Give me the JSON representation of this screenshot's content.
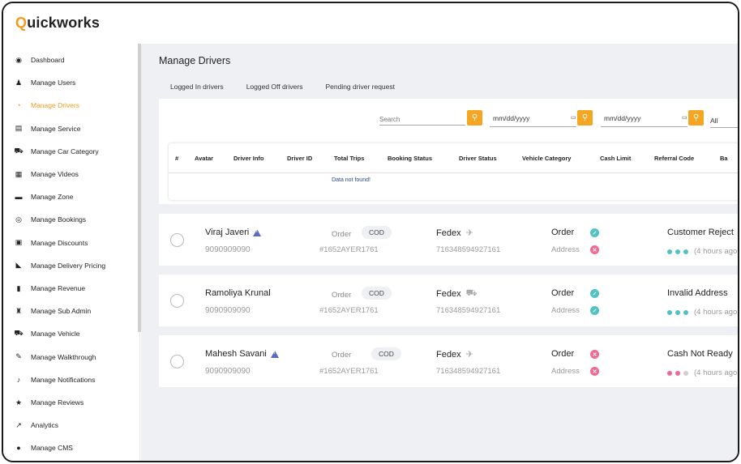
{
  "app": {
    "logo_first": "Q",
    "logo_rest": "uickworks"
  },
  "sidebar": {
    "items": [
      {
        "label": "Dashboard",
        "icon": "dashboard-icon",
        "glyph": "◉"
      },
      {
        "label": "Manage Users",
        "icon": "user-icon",
        "glyph": "♟"
      },
      {
        "label": "Manage Drivers",
        "icon": "driver-icon",
        "glyph": "◔",
        "active": true
      },
      {
        "label": "Manage Service",
        "icon": "service-icon",
        "glyph": "▤"
      },
      {
        "label": "Manage Car Category",
        "icon": "car-icon",
        "glyph": "⛟"
      },
      {
        "label": "Manage Videos",
        "icon": "calendar-icon",
        "glyph": "▦"
      },
      {
        "label": "Manage Zone",
        "icon": "briefcase-icon",
        "glyph": "▬"
      },
      {
        "label": "Manage Bookings",
        "icon": "target-icon",
        "glyph": "◎"
      },
      {
        "label": "Manage Discounts",
        "icon": "image-icon",
        "glyph": "▣"
      },
      {
        "label": "Manage Delivery Pricing",
        "icon": "area-chart-icon",
        "glyph": "◣"
      },
      {
        "label": "Manage Revenue",
        "icon": "bar-chart-icon",
        "glyph": "▮"
      },
      {
        "label": "Manage Sub Admin",
        "icon": "admin-icon",
        "glyph": "♜"
      },
      {
        "label": "Manage Vehicle",
        "icon": "vehicle-icon",
        "glyph": "⛟"
      },
      {
        "label": "Manage Walkthrough",
        "icon": "walkthrough-icon",
        "glyph": "✎"
      },
      {
        "label": "Manage Notifications",
        "icon": "bell-icon",
        "glyph": "♪"
      },
      {
        "label": "Manage Reviews",
        "icon": "star-icon",
        "glyph": "★"
      },
      {
        "label": "Analytics",
        "icon": "analytics-icon",
        "glyph": "↗"
      },
      {
        "label": "Manage CMS",
        "icon": "info-icon",
        "glyph": "●"
      }
    ]
  },
  "main": {
    "title": "Manage Drivers",
    "tabs": [
      {
        "label": "Logged In drivers",
        "active": true
      },
      {
        "label": "Logged Off drivers"
      },
      {
        "label": "Pending driver request"
      }
    ],
    "filters": {
      "search_placeholder": "Search",
      "date1": "mm/dd/yyyy",
      "date2": "mm/dd/yyyy",
      "select_value": "All"
    },
    "table": {
      "headers": [
        "#",
        "Avatar",
        "Driver Info",
        "Driver ID",
        "Total Trips",
        "Booking Status",
        "Driver Status",
        "Vehicle Category",
        "Cash Limit",
        "Referral Code",
        "Ba"
      ],
      "empty_message": "Data not found!"
    }
  },
  "orders": [
    {
      "name": "Viraj Javeri",
      "warning": true,
      "phone": "9090909090",
      "order_label": "Order",
      "payment": "COD",
      "order_no": "#1652AYER1761",
      "carrier": "Fedex",
      "carrier_icon": "plane-icon",
      "carrier_glyph": "✈",
      "tracking": "716348594927161",
      "status_label": "Order",
      "order_ok": true,
      "address_label": "Address",
      "address_ok": false,
      "status_text": "Customer Reject",
      "dots": [
        "#4fc3c4",
        "#4fc3c4",
        "#4fc3c4"
      ],
      "time": "(4 hours ago"
    },
    {
      "name": "Ramoliya Krunal",
      "warning": false,
      "phone": "9090909090",
      "order_label": "Order",
      "payment": "COD",
      "order_no": "#1652AYER1761",
      "carrier": "Fedex",
      "carrier_icon": "truck-icon",
      "carrier_glyph": "⛟",
      "tracking": "716348594927161",
      "status_label": "Order",
      "order_ok": true,
      "address_label": "Address",
      "address_ok": true,
      "status_text": "Invalid Address",
      "dots": [
        "#4fc3c4",
        "#4fc3c4",
        "#4fc3c4"
      ],
      "time": "(4 hours ago"
    },
    {
      "name": "Mahesh Savani",
      "warning": true,
      "phone": "9090909090",
      "order_label": "Order",
      "payment": "COD",
      "order_no": "#1652AYER1761",
      "carrier": "Fedex",
      "carrier_icon": "plane-icon",
      "carrier_glyph": "✈",
      "tracking": "716348594927161",
      "status_label": "Order",
      "order_ok": false,
      "address_label": "Address",
      "address_ok": false,
      "status_text": "Cash Not Ready",
      "dots": [
        "#ef6a93",
        "#ef6a93",
        "#cfcfcf"
      ],
      "time": "(4 hours ago"
    }
  ],
  "colors": {
    "accent": "#f29c1f",
    "ok": "#4fc3c4",
    "bad": "#ef6a93",
    "warning": "#5b6bbf"
  }
}
